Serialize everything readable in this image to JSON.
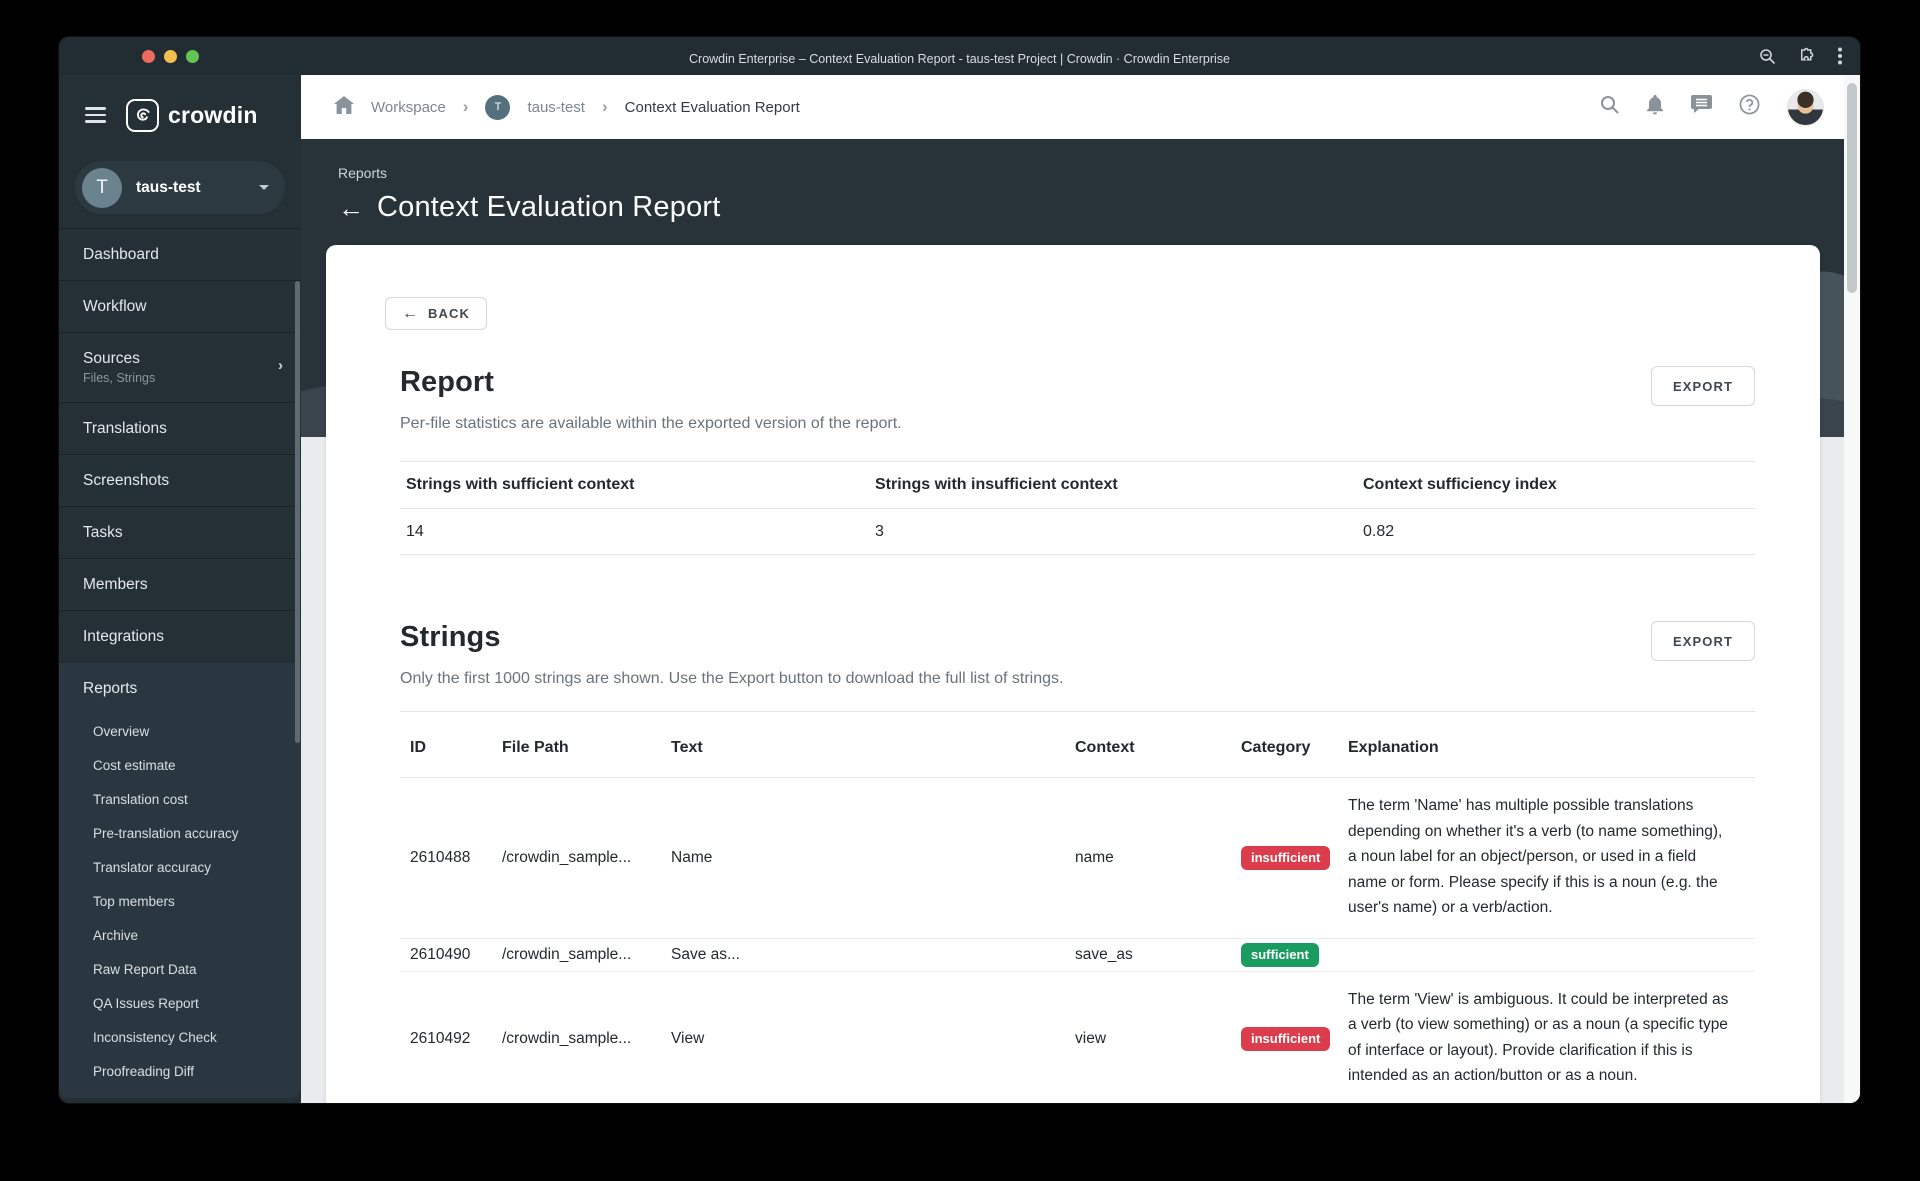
{
  "window": {
    "title": "Crowdin Enterprise – Context Evaluation Report - taus-test Project | Crowdin · Crowdin Enterprise",
    "traffic_lights": [
      "#ed6a5e",
      "#f4bf4f",
      "#61c554"
    ],
    "titlebar_icons": [
      "zoom-icon",
      "extensions-icon",
      "kebab-menu-icon"
    ]
  },
  "topnav": {
    "breadcrumb": {
      "workspace": "Workspace",
      "project": "taus-test",
      "project_initial": "T",
      "current": "Context Evaluation Report"
    },
    "icons": [
      "search-icon",
      "notifications-bell-icon",
      "messages-icon",
      "help-icon",
      "user-avatar"
    ]
  },
  "sidebar": {
    "brand": "crowdin",
    "project": {
      "name": "taus-test",
      "initial": "T"
    },
    "items": [
      {
        "label": "Dashboard"
      },
      {
        "label": "Workflow"
      },
      {
        "label": "Sources",
        "subtitle": "Files, Strings"
      },
      {
        "label": "Translations"
      },
      {
        "label": "Screenshots"
      },
      {
        "label": "Tasks"
      },
      {
        "label": "Members"
      },
      {
        "label": "Integrations"
      }
    ],
    "reports": {
      "label": "Reports",
      "subitems": [
        {
          "label": "Overview"
        },
        {
          "label": "Cost estimate"
        },
        {
          "label": "Translation cost"
        },
        {
          "label": "Pre-translation accuracy"
        },
        {
          "label": "Translator accuracy"
        },
        {
          "label": "Top members"
        },
        {
          "label": "Archive"
        },
        {
          "label": "Raw Report Data"
        },
        {
          "label": "QA Issues Report"
        },
        {
          "label": "Inconsistency Check"
        },
        {
          "label": "Proofreading Diff"
        }
      ]
    }
  },
  "page_header": {
    "eyebrow": "Reports",
    "back_arrow": "←",
    "title": "Context Evaluation Report"
  },
  "report": {
    "back_label": "BACK",
    "title": "Report",
    "subtitle": "Per-file statistics are available within the exported version of the report.",
    "export_label": "EXPORT",
    "stats_columns": [
      "Strings with sufficient context",
      "Strings with insufficient context",
      "Context sufficiency index"
    ],
    "stats_values": [
      "14",
      "3",
      "0.82"
    ]
  },
  "strings": {
    "title": "Strings",
    "subtitle": "Only the first 1000 strings are shown. Use the Export button to download the full list of strings.",
    "export_label": "EXPORT",
    "columns": [
      "ID",
      "File Path",
      "Text",
      "Context",
      "Category",
      "Explanation"
    ],
    "rows": [
      {
        "id": "2610488",
        "file_path": "/crowdin_sample...",
        "text": "Name",
        "context": "name",
        "category": "insufficient",
        "explanation": "The term 'Name' has multiple possible translations depending on whether it's a verb (to name something), a noun label for an object/person, or used in a field name or form. Please specify if this is a noun (e.g. the user's name) or a verb/action."
      },
      {
        "id": "2610490",
        "file_path": "/crowdin_sample...",
        "text": "Save as...",
        "context": "save_as",
        "category": "sufficient",
        "explanation": ""
      },
      {
        "id": "2610492",
        "file_path": "/crowdin_sample...",
        "text": "View",
        "context": "view",
        "category": "insufficient",
        "explanation": "The term 'View' is ambiguous. It could be interpreted as a verb (to view something) or as a noun (a specific type of interface or layout). Provide clarification if this is intended as an action/button or as a noun."
      }
    ]
  },
  "colors": {
    "insufficient_badge": "#dc3d4c",
    "sufficient_badge": "#1a9c61",
    "header_dark": "#273239",
    "sidebar_dark": "#242f36"
  }
}
